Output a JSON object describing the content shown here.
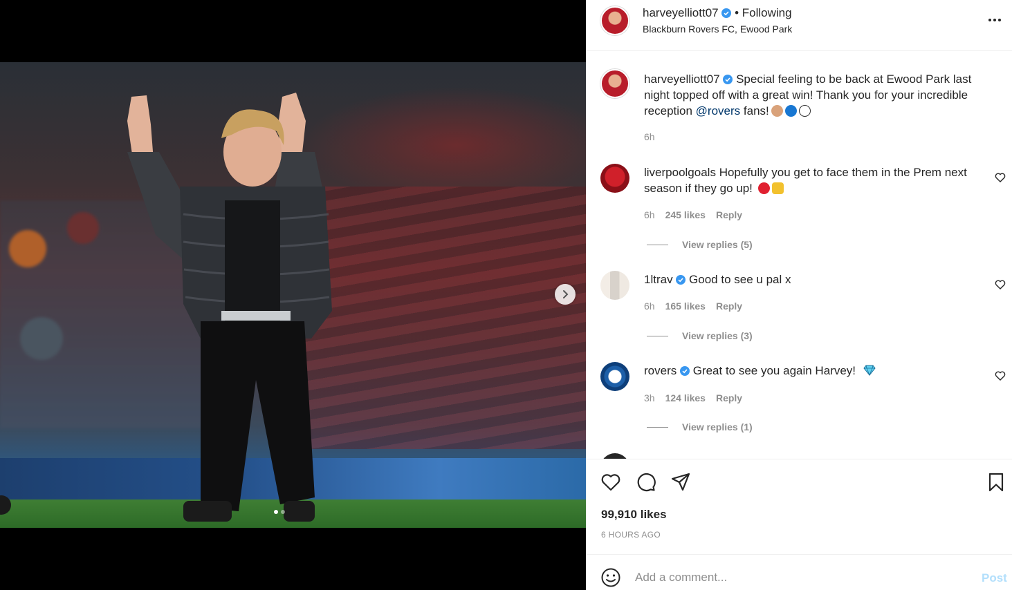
{
  "post": {
    "author": "harveyelliott07",
    "follow_state": "Following",
    "separator": "•",
    "location": "Blackburn Rovers FC, Ewood Park",
    "caption_text": "Special feeling to be back at Ewood Park last night topped off with a great win! Thank you for your incredible reception ",
    "caption_mention": "@rovers",
    "caption_suffix": " fans!",
    "caption_time": "6h"
  },
  "comments": [
    {
      "user": "liverpoolgoals",
      "text": "Hopefully you get to face them in the Prem next season if they go up!",
      "time": "6h",
      "likes": "245 likes",
      "reply_label": "Reply",
      "view_replies": "View replies (5)"
    },
    {
      "user": "1ltrav",
      "text": "Good to see u pal x",
      "time": "6h",
      "likes": "165 likes",
      "reply_label": "Reply",
      "view_replies": "View replies (3)"
    },
    {
      "user": "rovers",
      "text": "Great to see you again Harvey!",
      "time": "3h",
      "likes": "124 likes",
      "reply_label": "Reply",
      "view_replies": "View replies (1)"
    }
  ],
  "stats": {
    "likes": "99,910 likes",
    "posted": "6 HOURS AGO"
  },
  "composer": {
    "placeholder": "Add a comment...",
    "post_label": "Post"
  },
  "carousel": {
    "current_slide": 1,
    "total_slides": 2
  },
  "colors": {
    "verified": "#3897f0",
    "mention": "#00376b",
    "post_disabled": "#b2dffc",
    "secondary_text": "#8e8e8e"
  },
  "icons": [
    "more-icon",
    "verified-icon",
    "heart-icon",
    "comment-icon",
    "share-icon",
    "bookmark-icon",
    "smile-icon",
    "chevron-right-icon"
  ]
}
